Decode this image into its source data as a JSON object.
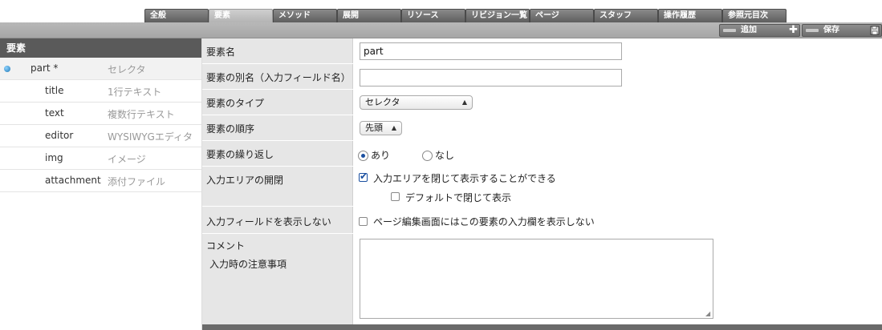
{
  "tabs": [
    "全般",
    "要素",
    "メソッド",
    "展開",
    "リソース",
    "リビジョン一覧",
    "ページ",
    "スタッフ",
    "操作履歴",
    "参照元目次"
  ],
  "toolbar": {
    "add_label": "追加",
    "save_label": "保存",
    "add_icon": "plus-icon",
    "save_icon": "save-icon"
  },
  "left": {
    "header": "要素",
    "elements": [
      {
        "name": "part *",
        "type": "セレクタ"
      },
      {
        "name": "title",
        "type": "1行テキスト"
      },
      {
        "name": "text",
        "type": "複数行テキスト"
      },
      {
        "name": "editor",
        "type": "WYSIWYGエディタ"
      },
      {
        "name": "img",
        "type": "イメージ"
      },
      {
        "name": "attachment",
        "type": "添付ファイル"
      }
    ]
  },
  "form": {
    "name_label": "要素名",
    "name_value": "part",
    "alias_label": "要素の別名（入力フィールド名）",
    "alias_value": "",
    "type_label": "要素のタイプ",
    "type_value": "セレクタ",
    "order_label": "要素の順序",
    "order_value": "先頭",
    "repeat_label": "要素の繰り返し",
    "repeat_yes": "あり",
    "repeat_no": "なし",
    "collapse_label": "入力エリアの開閉",
    "collapse_option": "入力エリアを閉じて表示することができる",
    "collapse_default": "デフォルトで閉じて表示",
    "hide_label": "入力フィールドを表示しない",
    "hide_option": "ページ編集画面にはこの要素の入力欄を表示しない",
    "comment_label": "コメント",
    "comment_sub": "入力時の注意事項"
  }
}
